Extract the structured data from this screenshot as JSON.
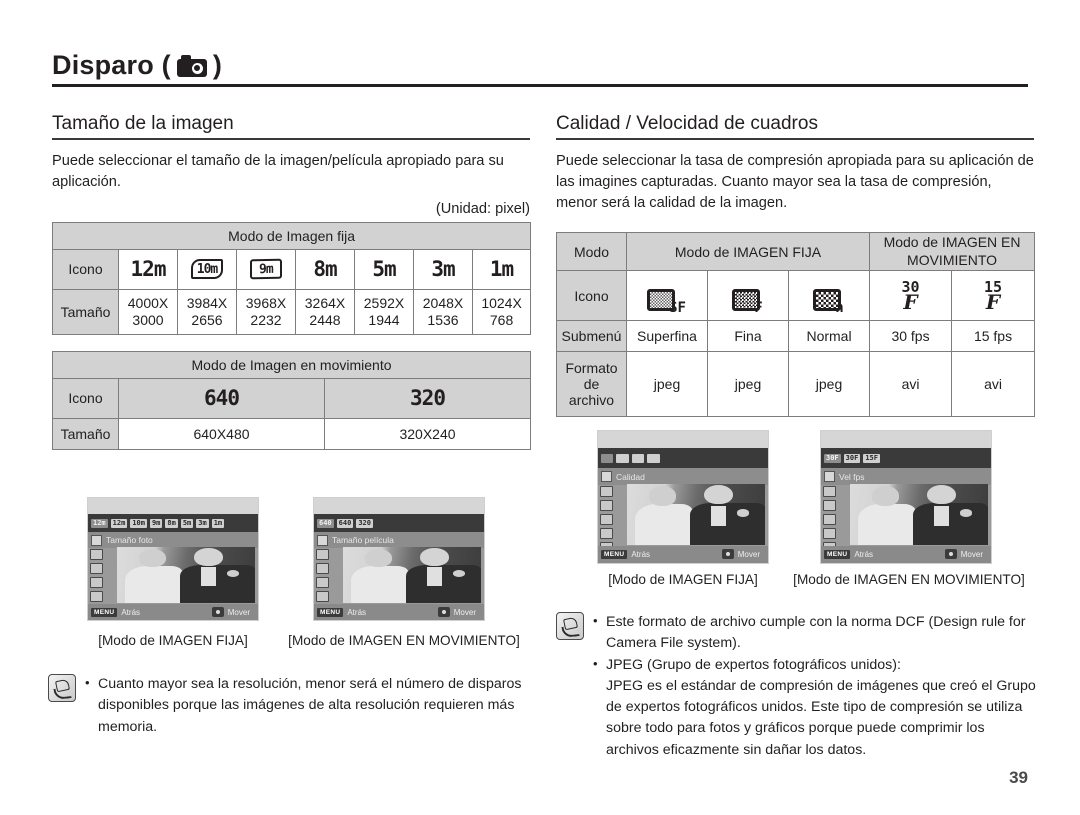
{
  "header": {
    "title": "Disparo (",
    "title_close": ")",
    "icon": "camera-icon"
  },
  "page_number": "39",
  "left": {
    "section_title": "Tamaño de la imagen",
    "intro": "Puede seleccionar el tamaño de la imagen/película apropiado para su aplicación.",
    "unit_note": "(Unidad: pixel)",
    "still_table": {
      "caption": "Modo de Imagen fija",
      "row_labels": [
        "Icono",
        "Tamaño"
      ],
      "icons": [
        "12m",
        "10m",
        "9m",
        "8m",
        "5m",
        "3m",
        "1m"
      ],
      "sizes": [
        "4000X\n3000",
        "3984X\n2656",
        "3968X\n2232",
        "3264X\n2448",
        "2592X\n1944",
        "2048X\n1536",
        "1024X\n768"
      ],
      "sizes_top": [
        "4000X",
        "3984X",
        "3968X",
        "3264X",
        "2592X",
        "2048X",
        "1024X"
      ],
      "sizes_bottom": [
        "3000",
        "2656",
        "2232",
        "2448",
        "1944",
        "1536",
        "768"
      ]
    },
    "movie_table": {
      "caption": "Modo de Imagen en movimiento",
      "row_labels": [
        "Icono",
        "Tamaño"
      ],
      "icons": [
        "640",
        "320"
      ],
      "sizes": [
        "640X480",
        "320X240"
      ]
    },
    "shots": [
      {
        "menu_label": "Tamaño foto",
        "chips": [
          "12m",
          "12m",
          "10m",
          "9m",
          "8m",
          "5m",
          "3m",
          "1m"
        ],
        "back_label": "Atrás",
        "move_label": "Mover",
        "menu_button": "MENU",
        "caption": "[Modo de IMAGEN FIJA]"
      },
      {
        "menu_label": "Tamaño película",
        "chips": [
          "640",
          "640",
          "320"
        ],
        "back_label": "Atrás",
        "move_label": "Mover",
        "menu_button": "MENU",
        "caption": "[Modo de IMAGEN EN MOVIMIENTO]"
      }
    ],
    "note": {
      "items": [
        "Cuanto mayor sea la resolución, menor será el número de disparos disponibles porque las imágenes de alta resolución requieren más memoria."
      ]
    }
  },
  "right": {
    "section_title": "Calidad / Velocidad de cuadros",
    "intro": "Puede seleccionar la tasa de compresión apropiada para su aplicación de las imagines capturadas. Cuanto mayor sea la tasa de compresión, menor será la calidad de la imagen.",
    "quality_table": {
      "row_labels": [
        "Modo",
        "Icono",
        "Submenú",
        "Formato de archivo"
      ],
      "row_label_4_line1": "Formato de",
      "row_label_4_line2": "archivo",
      "group_headers": [
        "Modo de IMAGEN FIJA",
        "Modo de IMAGEN EN MOVIMIENTO"
      ],
      "group_header_2_line1": "Modo de IMAGEN EN",
      "group_header_2_line2": "MOVIMIENTO",
      "icons": [
        "SF",
        "F",
        "n",
        "30F",
        "15F"
      ],
      "fps_nums": [
        "30",
        "15"
      ],
      "submenu": [
        "Superfina",
        "Fina",
        "Normal",
        "30 fps",
        "15 fps"
      ],
      "file_format": [
        "jpeg",
        "jpeg",
        "jpeg",
        "avi",
        "avi"
      ]
    },
    "shots": [
      {
        "menu_label": "Calidad",
        "back_label": "Atrás",
        "move_label": "Mover",
        "menu_button": "MENU",
        "caption": "[Modo de IMAGEN FIJA]"
      },
      {
        "menu_label": "Vel fps",
        "chips": [
          "30F",
          "30F",
          "15F"
        ],
        "back_label": "Atrás",
        "move_label": "Mover",
        "menu_button": "MENU",
        "caption": "[Modo de IMAGEN EN MOVIMIENTO]"
      }
    ],
    "note": {
      "item1": "Este formato de archivo cumple con la norma DCF (Design rule for Camera File system).",
      "item2": "JPEG (Grupo de expertos fotográficos unidos):",
      "item2_body": "JPEG es el estándar de compresión de imágenes que creó el Grupo de expertos fotográficos unidos. Este tipo de compresión se utiliza sobre todo para fotos y gráficos porque puede comprimir los archivos eficazmente sin dañar los datos."
    }
  },
  "colors": {
    "table_header": "#d2d2d2",
    "border": "#7d7d7d",
    "text": "#231f20"
  }
}
